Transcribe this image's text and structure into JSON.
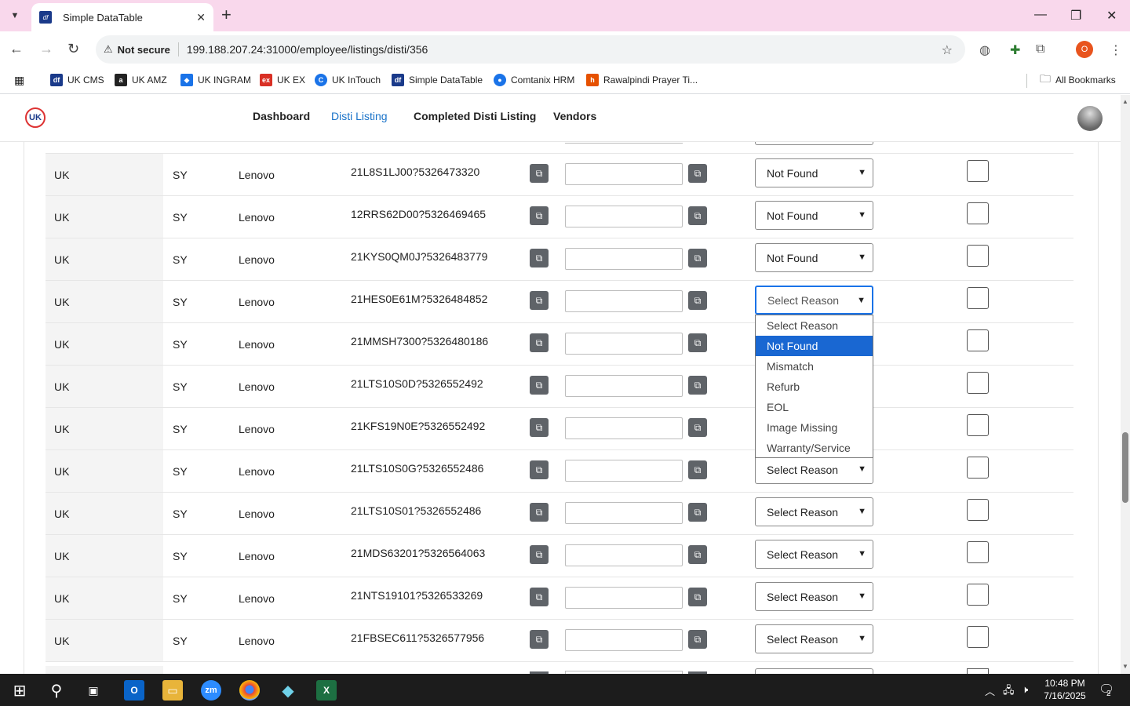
{
  "browser": {
    "tab_title": "Simple DataTable",
    "tab_favicon": "df",
    "not_secure": "Not secure",
    "url": "199.188.207.24:31000/employee/listings/disti/356",
    "profile_initial": "O",
    "bookmarks": [
      {
        "label": "UK CMS",
        "icon": "df",
        "color": "#1a3a8a"
      },
      {
        "label": "UK AMZ",
        "icon": "a",
        "color": "#222222"
      },
      {
        "label": "UK INGRAM",
        "icon": "◆",
        "color": "#1a73e8"
      },
      {
        "label": "UK EX",
        "icon": "ex",
        "color": "#d93025"
      },
      {
        "label": "UK InTouch",
        "icon": "C",
        "color": "#1a73e8"
      },
      {
        "label": "Simple DataTable",
        "icon": "df",
        "color": "#1a3a8a"
      },
      {
        "label": "Comtanix HRM",
        "icon": "●",
        "color": "#1a73e8"
      },
      {
        "label": "Rawalpindi Prayer Ti...",
        "icon": "h",
        "color": "#e65100"
      }
    ],
    "all_bookmarks": "All Bookmarks"
  },
  "app": {
    "logo_text": "UK",
    "nav": [
      "Dashboard",
      "Disti Listing",
      "Completed Disti Listing",
      "Vendors"
    ],
    "active_nav": "Disti Listing"
  },
  "rows": [
    {
      "country": "UK",
      "code": "SY",
      "brand": "Lenovo",
      "sku": "21L8S1LJ00?5326473320",
      "reason": "Not Found"
    },
    {
      "country": "UK",
      "code": "SY",
      "brand": "Lenovo",
      "sku": "12RRS62D00?5326469465",
      "reason": "Not Found"
    },
    {
      "country": "UK",
      "code": "SY",
      "brand": "Lenovo",
      "sku": "21KYS0QM0J?5326483779",
      "reason": "Not Found"
    },
    {
      "country": "UK",
      "code": "SY",
      "brand": "Lenovo",
      "sku": "21HES0E61M?5326484852",
      "reason": "Select Reason"
    },
    {
      "country": "UK",
      "code": "SY",
      "brand": "Lenovo",
      "sku": "21MMSH7300?5326480186",
      "reason": ""
    },
    {
      "country": "UK",
      "code": "SY",
      "brand": "Lenovo",
      "sku": "21LTS10S0D?5326552492",
      "reason": ""
    },
    {
      "country": "UK",
      "code": "SY",
      "brand": "Lenovo",
      "sku": "21KFS19N0E?5326552492",
      "reason": ""
    },
    {
      "country": "UK",
      "code": "SY",
      "brand": "Lenovo",
      "sku": "21LTS10S0G?5326552486",
      "reason": "Select Reason"
    },
    {
      "country": "UK",
      "code": "SY",
      "brand": "Lenovo",
      "sku": "21LTS10S01?5326552486",
      "reason": "Select Reason"
    },
    {
      "country": "UK",
      "code": "SY",
      "brand": "Lenovo",
      "sku": "21MDS63201?5326564063",
      "reason": "Select Reason"
    },
    {
      "country": "UK",
      "code": "SY",
      "brand": "Lenovo",
      "sku": "21NTS19101?5326533269",
      "reason": "Select Reason"
    },
    {
      "country": "UK",
      "code": "SY",
      "brand": "Lenovo",
      "sku": "21FBSEC611?5326577956",
      "reason": "Select Reason"
    }
  ],
  "dropdown": {
    "options": [
      "Select Reason",
      "Not Found",
      "Mismatch",
      "Refurb",
      "EOL",
      "Image Missing",
      "Warranty/Service"
    ],
    "highlighted": "Not Found"
  },
  "taskbar": {
    "time": "10:48 PM",
    "date": "7/16/2025",
    "notifications": "2"
  }
}
